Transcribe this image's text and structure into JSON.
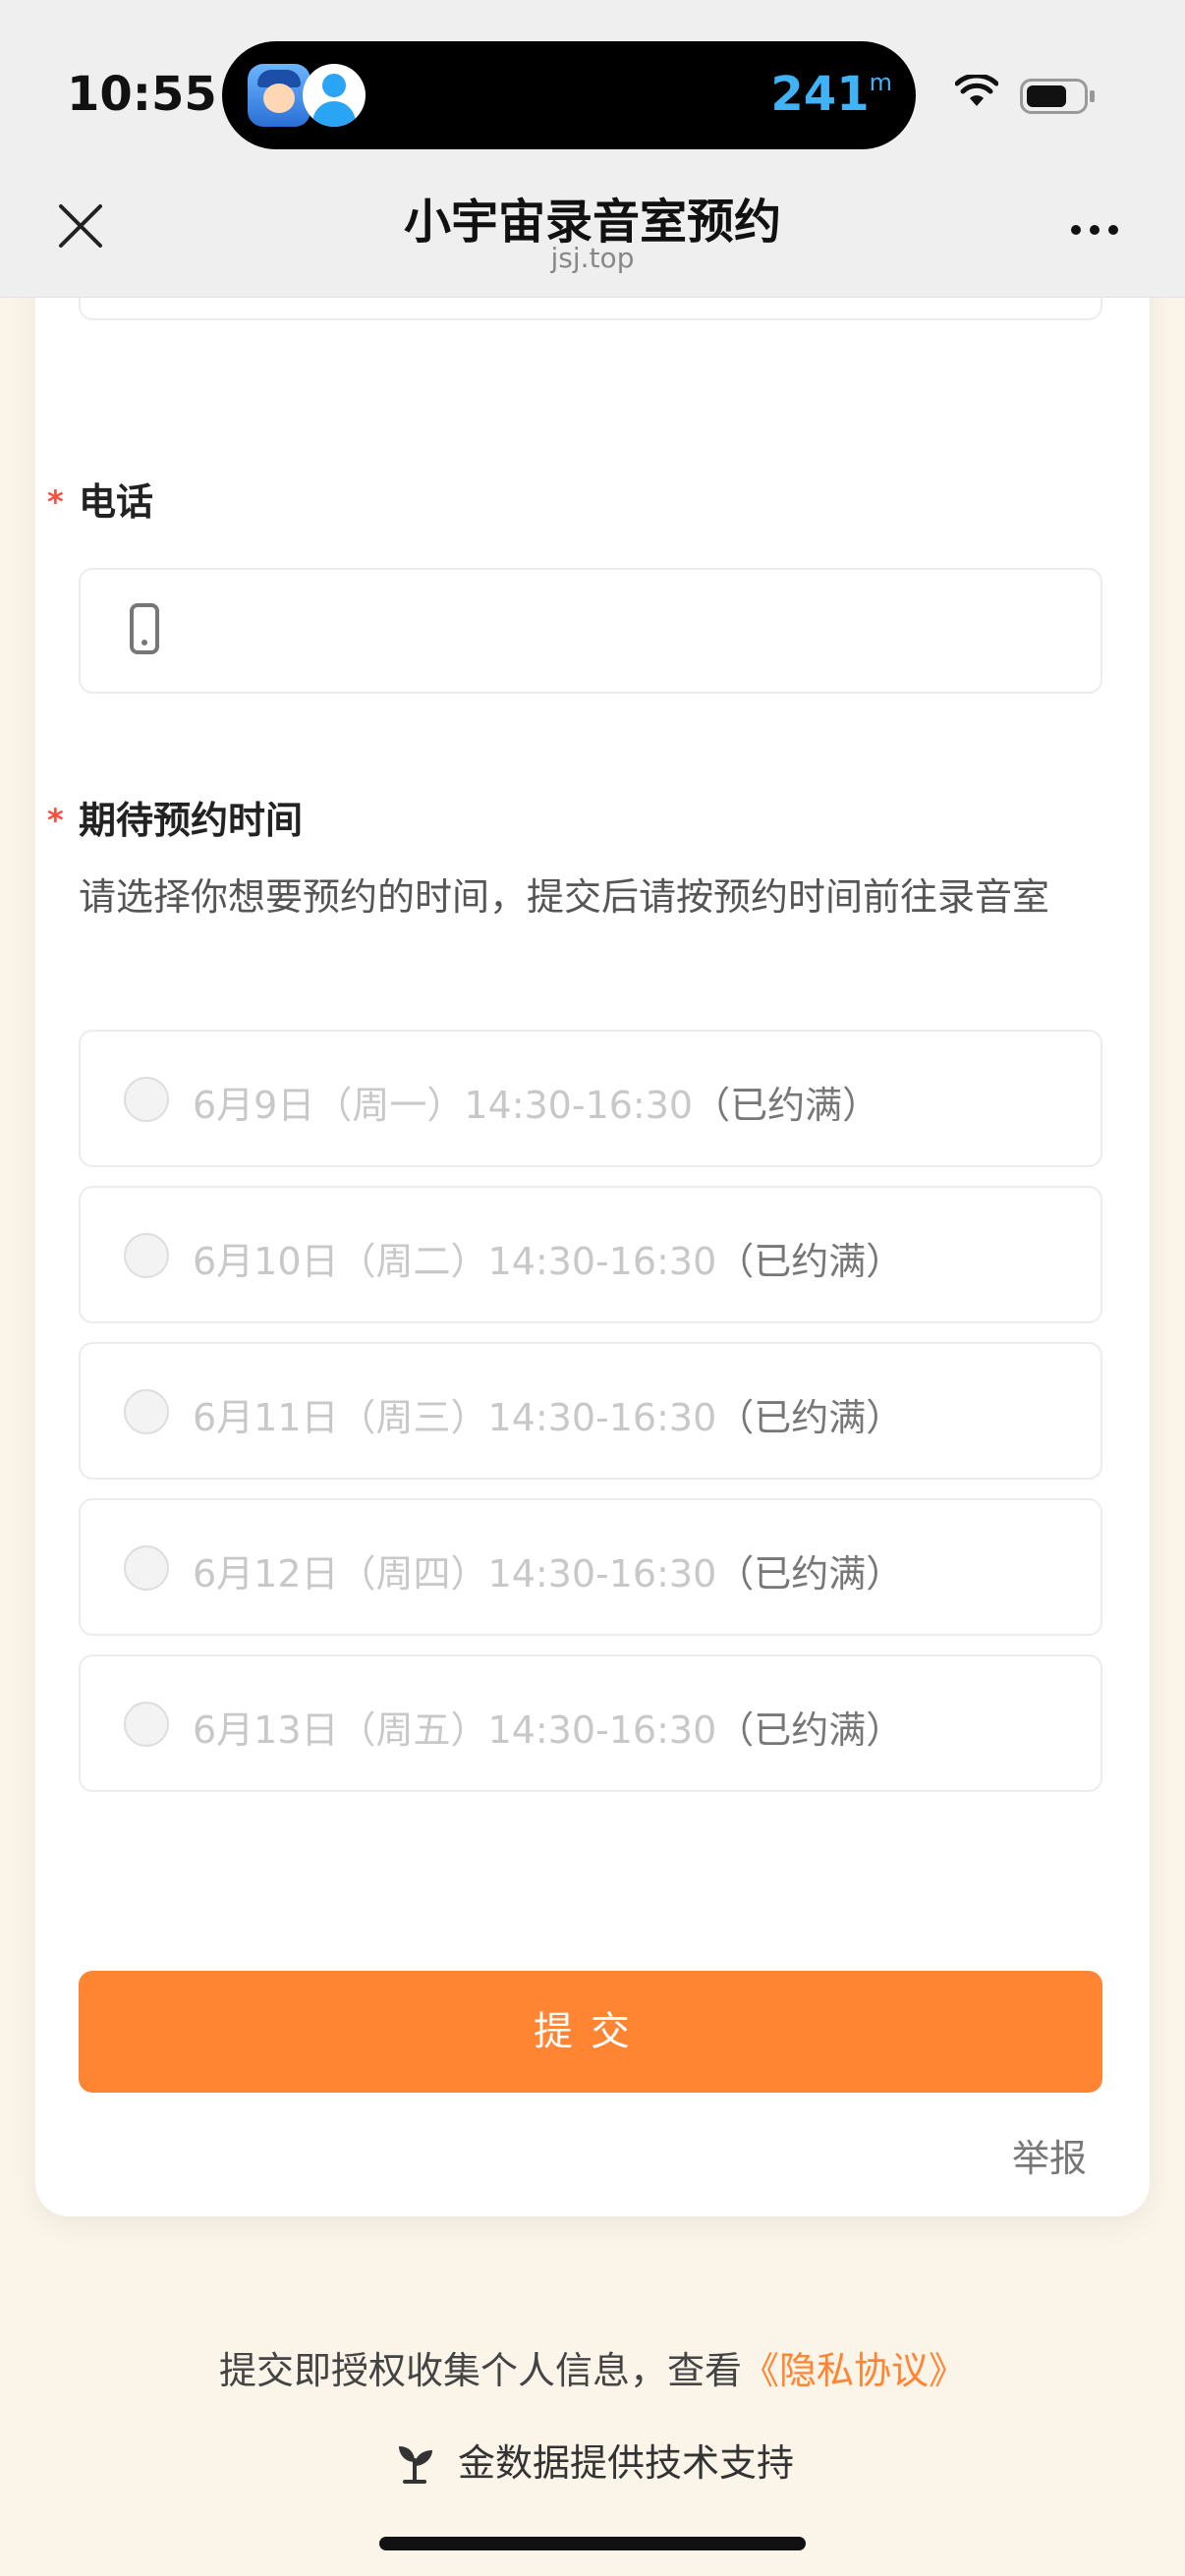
{
  "status_bar": {
    "time": "10:55",
    "distance_value": "241",
    "distance_unit": "m"
  },
  "nav": {
    "title": "小宇宙录音室预约",
    "url": "jsj.top"
  },
  "form": {
    "phone_label": "电话",
    "time_label": "期待预约时间",
    "time_hint": "请选择你想要预约的时间，提交后请按预约时间前往录音室",
    "options": [
      {
        "text": "6月9日（周一）14:30-16:30",
        "status": "（已约满）"
      },
      {
        "text": "6月10日（周二）14:30-16:30",
        "status": "（已约满）"
      },
      {
        "text": "6月11日（周三）14:30-16:30",
        "status": "（已约满）"
      },
      {
        "text": "6月12日（周四）14:30-16:30",
        "status": "（已约满）"
      },
      {
        "text": "6月13日（周五）14:30-16:30",
        "status": "（已约满）"
      }
    ],
    "submit_label": "提交",
    "report_label": "举报"
  },
  "footer": {
    "consent_text": "提交即授权收集个人信息，查看",
    "privacy_link": "《隐私协议》",
    "support_text": "金数据提供技术支持"
  },
  "colors": {
    "accent": "#ff8532",
    "required": "#ff4d3d",
    "page_bg": "#fbf4e9"
  },
  "icons": [
    "close-icon",
    "more-icon",
    "phone-icon",
    "wifi-icon",
    "battery-icon",
    "jinshuju-leaf-icon"
  ]
}
